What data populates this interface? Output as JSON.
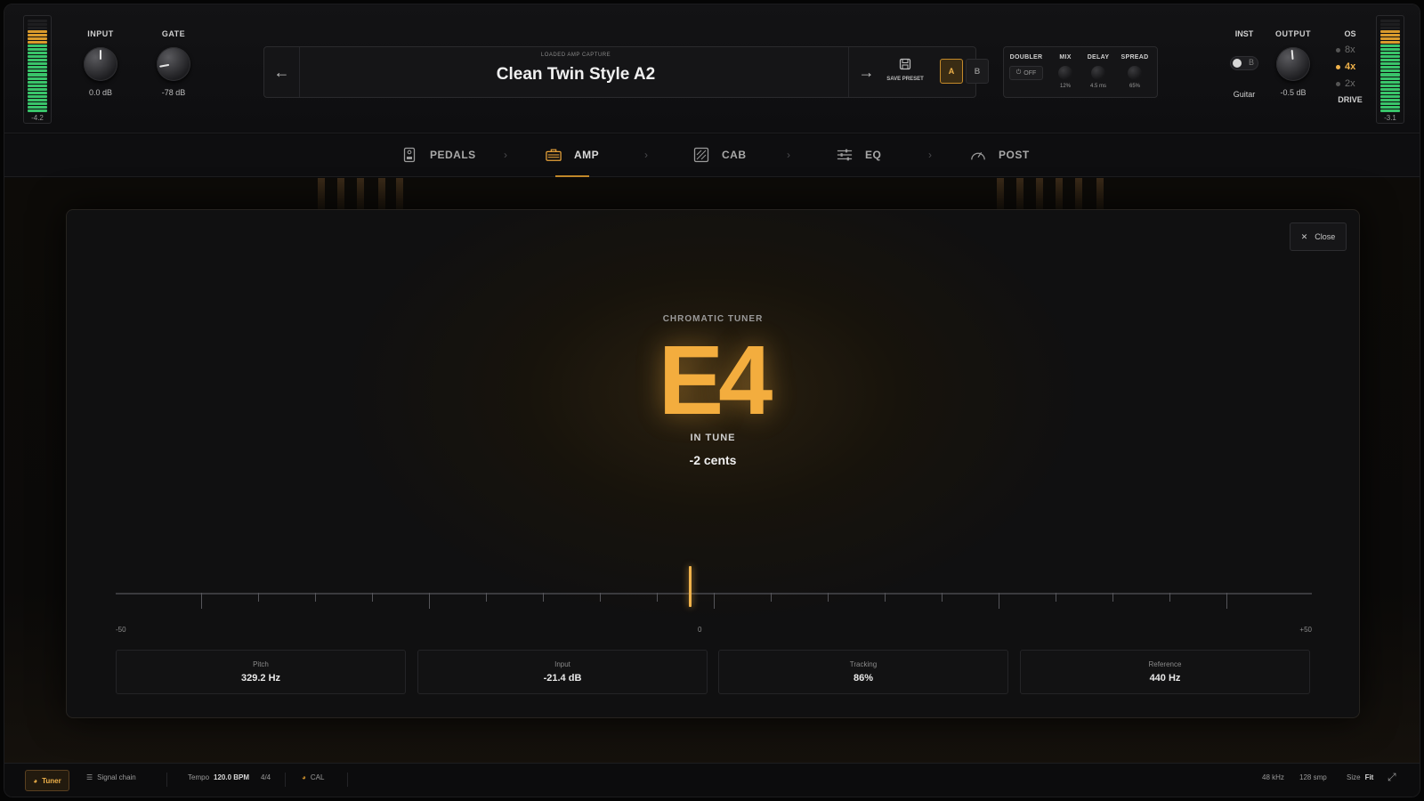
{
  "header": {
    "meter_left_value": "-4.2",
    "meter_right_value": "-3.1",
    "input": {
      "label": "INPUT",
      "value": "0.0 dB"
    },
    "gate": {
      "label": "GATE",
      "value": "-78 dB"
    },
    "capture": {
      "subtitle": "LOADED AMP CAPTURE",
      "name": "Clean Twin Style A2",
      "prev_icon": "arrow-left-icon",
      "next_icon": "arrow-right-icon",
      "save_label": "SAVE PRESET",
      "slot_a": "A",
      "slot_b": "B"
    },
    "doubler": {
      "label": "DOUBLER",
      "state": "OFF",
      "mix_label": "MIX",
      "mix_value": "12%",
      "delay_label": "DELAY",
      "delay_value": "4.5 ms",
      "spread_label": "SPREAD",
      "spread_value": "65%"
    },
    "inst": {
      "label": "INST",
      "toggle_letter": "B",
      "value": "Guitar"
    },
    "output": {
      "label": "OUTPUT",
      "value": "-0.5 dB"
    },
    "os": {
      "label": "OS",
      "options": [
        "8x",
        "4x",
        "2x"
      ],
      "selected": "4x",
      "drive_label": "DRIVE"
    }
  },
  "tabs": [
    {
      "label": "PEDALS",
      "icon": "pedal-icon"
    },
    {
      "label": "AMP",
      "icon": "amp-icon",
      "active": true
    },
    {
      "label": "CAB",
      "icon": "cab-icon"
    },
    {
      "label": "EQ",
      "icon": "eq-sliders-icon"
    },
    {
      "label": "POST",
      "icon": "gauge-icon"
    }
  ],
  "tuner": {
    "close_label": "Close",
    "title": "CHROMATIC TUNER",
    "note": "E4",
    "status": "IN TUNE",
    "cents_text": "-2 cents",
    "cents_value": -2,
    "scale_min_label": "-50",
    "scale_mid_label": "0",
    "scale_max_label": "+50",
    "stats": [
      {
        "label": "Pitch",
        "value": "329.2 Hz"
      },
      {
        "label": "Input",
        "value": "-21.4 dB"
      },
      {
        "label": "Tracking",
        "value": "86%"
      },
      {
        "label": "Reference",
        "value": "440 Hz"
      }
    ]
  },
  "statusbar": {
    "tuner_label": "Tuner",
    "signal_chain_label": "Signal chain",
    "tempo_label": "Tempo",
    "tempo_value": "120.0 BPM",
    "time_signature": "4/4",
    "cal_label": "CAL",
    "sample_rate": "48 kHz",
    "buffer": "128 smp",
    "size_label": "Size",
    "size_value": "Fit"
  },
  "colors": {
    "accent": "#f0b24a",
    "meter_green": "#39c46a",
    "meter_orange": "#d99a2c"
  }
}
